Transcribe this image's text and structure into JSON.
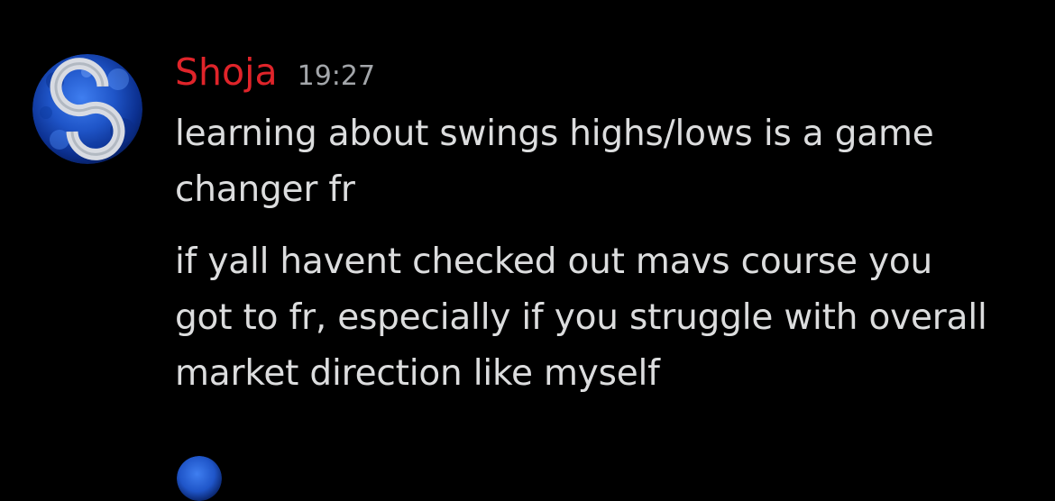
{
  "message": {
    "author": "Shoja",
    "author_color": "#e0242a",
    "timestamp": "19:27",
    "paragraphs": [
      {
        "lines": [
          "learning about swings highs/lows is a game",
          "changer fr"
        ]
      },
      {
        "lines": [
          "if yall havent checked out mavs course you",
          "got to fr, especially if you struggle with overall",
          "market direction like myself"
        ]
      }
    ]
  },
  "colors": {
    "background": "#000000",
    "text": "#dcddde",
    "timestamp": "#a3a6aa",
    "avatar_blue": "#1f55c8"
  },
  "icons": {
    "avatar": "user-avatar-icon",
    "next_avatar": "next-message-avatar-icon"
  }
}
